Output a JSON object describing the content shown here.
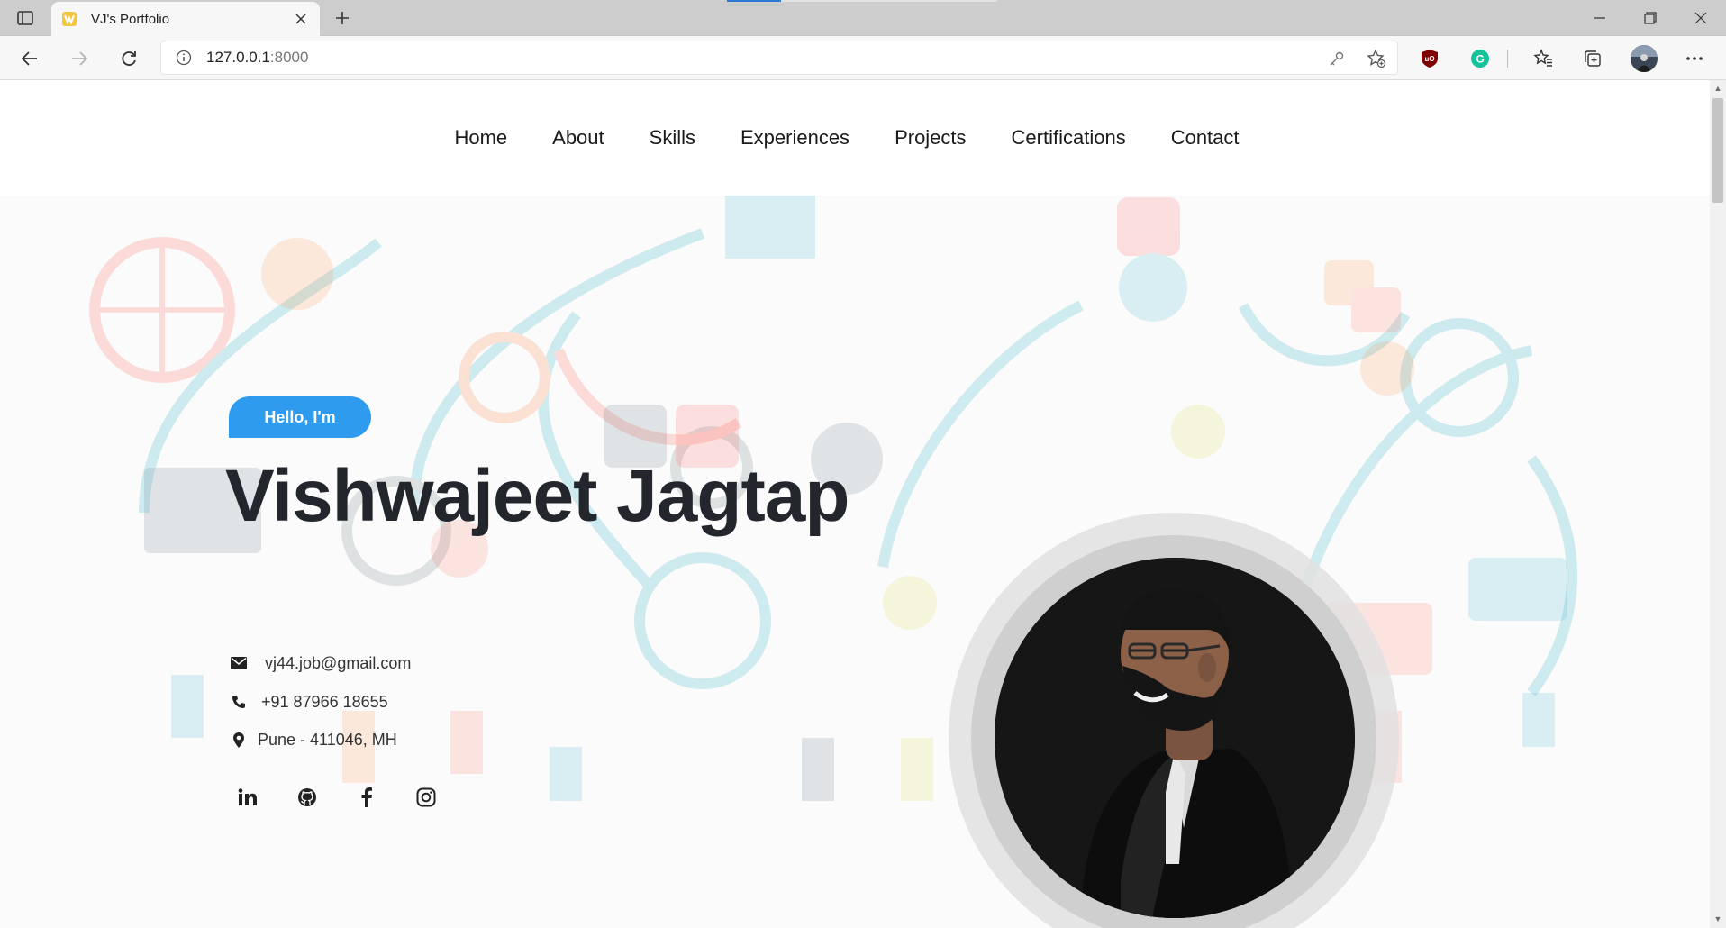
{
  "browser": {
    "tab_title": "VJ's Portfolio",
    "url_host": "127.0.0.1",
    "url_port": ":8000"
  },
  "nav": {
    "items": [
      "Home",
      "About",
      "Skills",
      "Experiences",
      "Projects",
      "Certifications",
      "Contact"
    ]
  },
  "hero": {
    "greeting": "Hello, I'm",
    "name": "Vishwajeet Jagtap",
    "email": "vj44.job@gmail.com",
    "phone": "+91 87966 18655",
    "location": "Pune - 411046, MH",
    "socials": [
      "linkedin-icon",
      "github-icon",
      "facebook-icon",
      "instagram-icon"
    ]
  },
  "colors": {
    "accent": "#2f9bee",
    "heading": "#23262d"
  }
}
